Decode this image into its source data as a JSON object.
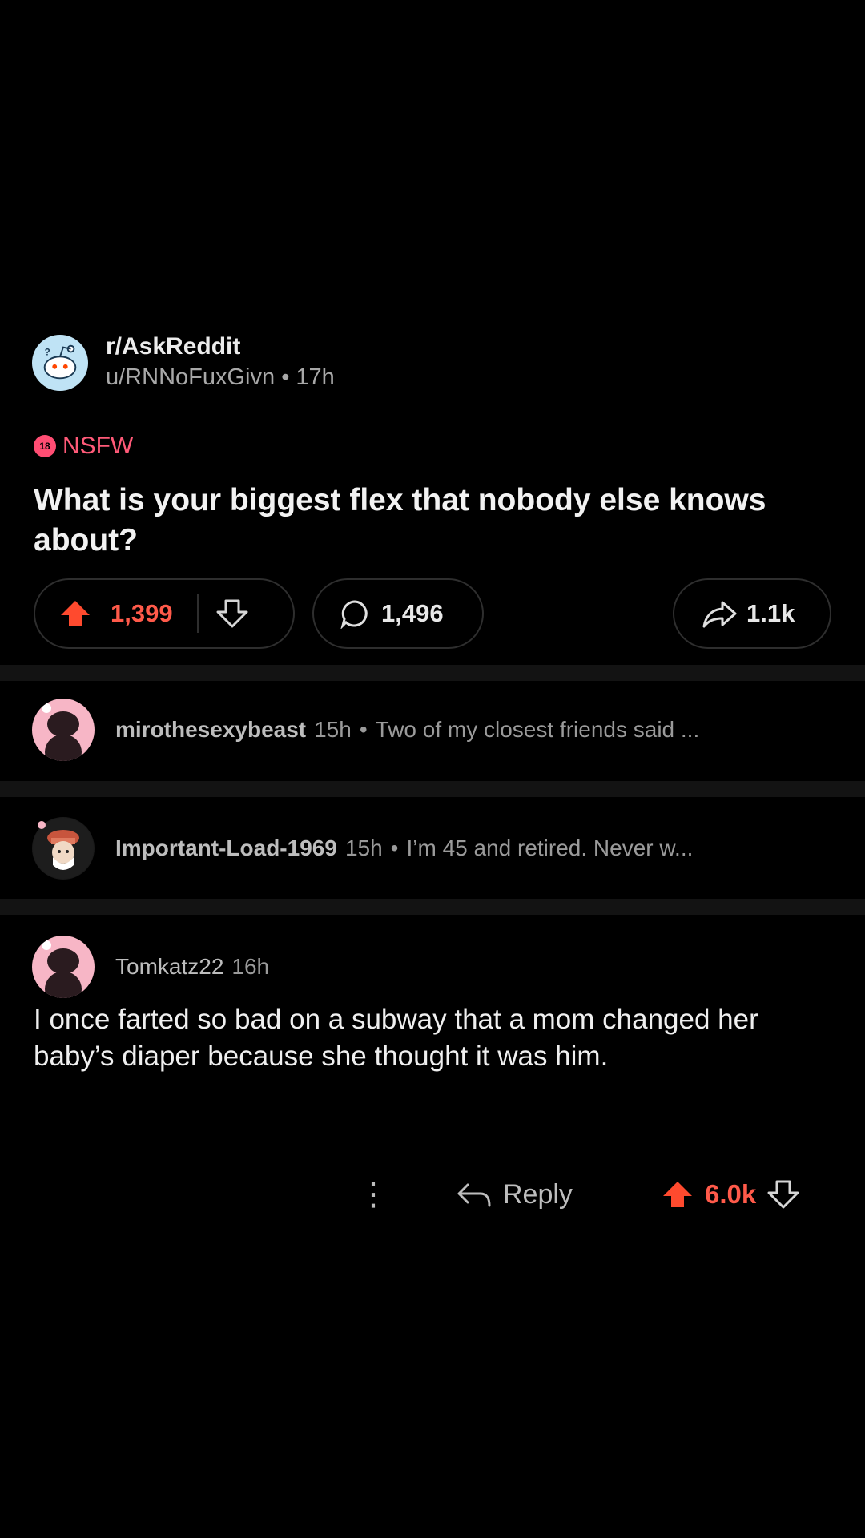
{
  "post": {
    "subreddit": "r/AskReddit",
    "author": "u/RNNoFuxGivn",
    "age": "17h",
    "nsfw_badge": "18",
    "nsfw_label": "NSFW",
    "title": "What is your biggest flex that nobody else knows about?",
    "upvotes": "1,399",
    "comments": "1,496",
    "shares": "1.1k"
  },
  "collapsed_comments": [
    {
      "user": "mirothesexybeast",
      "age": "15h",
      "separator": "•",
      "snippet": "Two of my closest friends said ..."
    },
    {
      "user": "Important-Load-1969",
      "age": "15h",
      "separator": "•",
      "snippet": "I’m 45 and retired.  Never w..."
    }
  ],
  "comment": {
    "user": "Tomkatz22",
    "age": "16h",
    "body": "I once farted so bad on a subway that a mom changed her baby’s diaper because she thought it was him.",
    "reply_label": "Reply",
    "score": "6.0k",
    "more_icon": "⋮"
  },
  "colors": {
    "upvote": "#ff4a2e",
    "nsfw": "#ff5a78",
    "background": "#000000"
  }
}
